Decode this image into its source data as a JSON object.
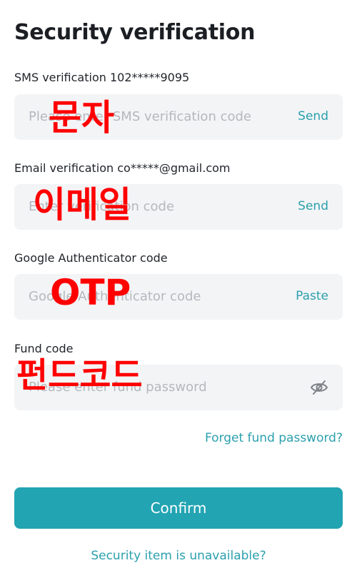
{
  "page": {
    "title": "Security verification"
  },
  "sms": {
    "label": "SMS verification 102*****9095",
    "placeholder": "Please enter SMS verification code",
    "action": "Send",
    "overlay": "문자"
  },
  "email": {
    "label": "Email verification co*****@gmail.com",
    "placeholder": "Enter verification code",
    "action": "Send",
    "overlay": "이메일"
  },
  "google": {
    "label": "Google Authenticator code",
    "placeholder": "Google Authenticator code",
    "action": "Paste",
    "overlay": "OTP"
  },
  "fund": {
    "label": "Fund code",
    "placeholder": "Please enter fund password",
    "icon": "eye-off-icon",
    "overlay": "펀드코드"
  },
  "links": {
    "forgot": "Forget fund password?",
    "unavailable": "Security item is unavailable?"
  },
  "buttons": {
    "confirm": "Confirm"
  },
  "colors": {
    "accent": "#22a4b3",
    "link": "#2ba0ad",
    "annotation": "#ff0000",
    "field_bg": "#f3f4f6"
  }
}
